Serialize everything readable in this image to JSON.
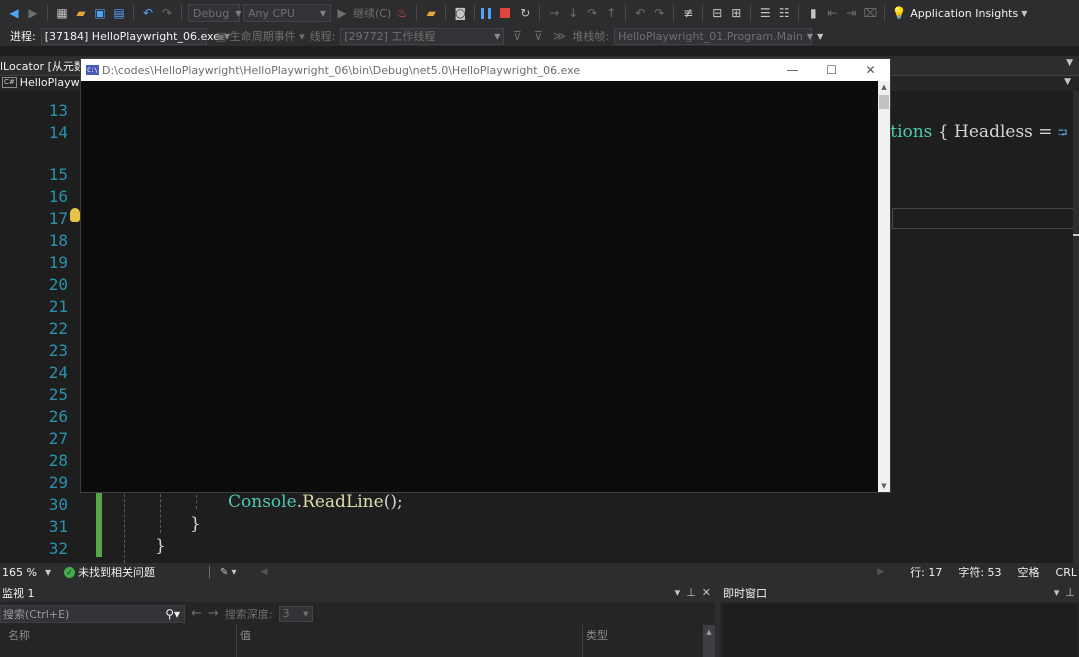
{
  "toolbar": {
    "config": "Debug",
    "platform": "Any CPU",
    "continue": "继续(C)",
    "app_insights": "Application Insights"
  },
  "debug_bar": {
    "process_label": "进程:",
    "process_value": "[37184] HelloPlaywright_06.exe",
    "lifecycle": "生命周期事件",
    "thread_label": "线程:",
    "thread_value": "[29772] 工作线程",
    "stackframe_label": "堆栈帧:",
    "stackframe_value": "HelloPlaywright_01.Program.Main"
  },
  "tabs": {
    "locator_tab": "lLocator [从元数",
    "project": "HelloPlaywrig"
  },
  "editor": {
    "line_numbers": [
      "13",
      "14",
      "15",
      "16",
      "17",
      "18",
      "19",
      "20",
      "21",
      "22",
      "23",
      "24",
      "25",
      "26",
      "27",
      "28",
      "29",
      "30",
      "31",
      "32"
    ],
    "code_line30_class": "Console",
    "code_line30_dot": ".",
    "code_line30_method": "ReadLine",
    "code_line30_rest": "();",
    "brace_31": "}",
    "brace_32": "}",
    "code_line14_type": "otions",
    "code_line14_rest": " { Headless = "
  },
  "console": {
    "title": "D:\\codes\\HelloPlaywright\\HelloPlaywright_06\\bin\\Debug\\net5.0\\HelloPlaywright_06.exe",
    "icon_text": "C:\\"
  },
  "status": {
    "zoom": "165 %",
    "issues": "未找到相关问题",
    "line": "行: 17",
    "char": "字符: 53",
    "whitespace": "空格",
    "line_ending": "CRL"
  },
  "watch": {
    "title": "监视 1",
    "search_placeholder": "搜索(Ctrl+E)",
    "depth_label": "搜索深度:",
    "depth_value": "3",
    "col_name": "名称",
    "col_value": "值",
    "col_type": "类型"
  },
  "immediate": {
    "title": "即时窗口"
  },
  "colors": {
    "editor_bg": "#1e1e1e",
    "chrome_bg": "#2d2d30",
    "line_number": "#2b91af",
    "type_color": "#4ec9b0",
    "method_color": "#dcdcaa",
    "console_bg": "#0c0c0c"
  }
}
